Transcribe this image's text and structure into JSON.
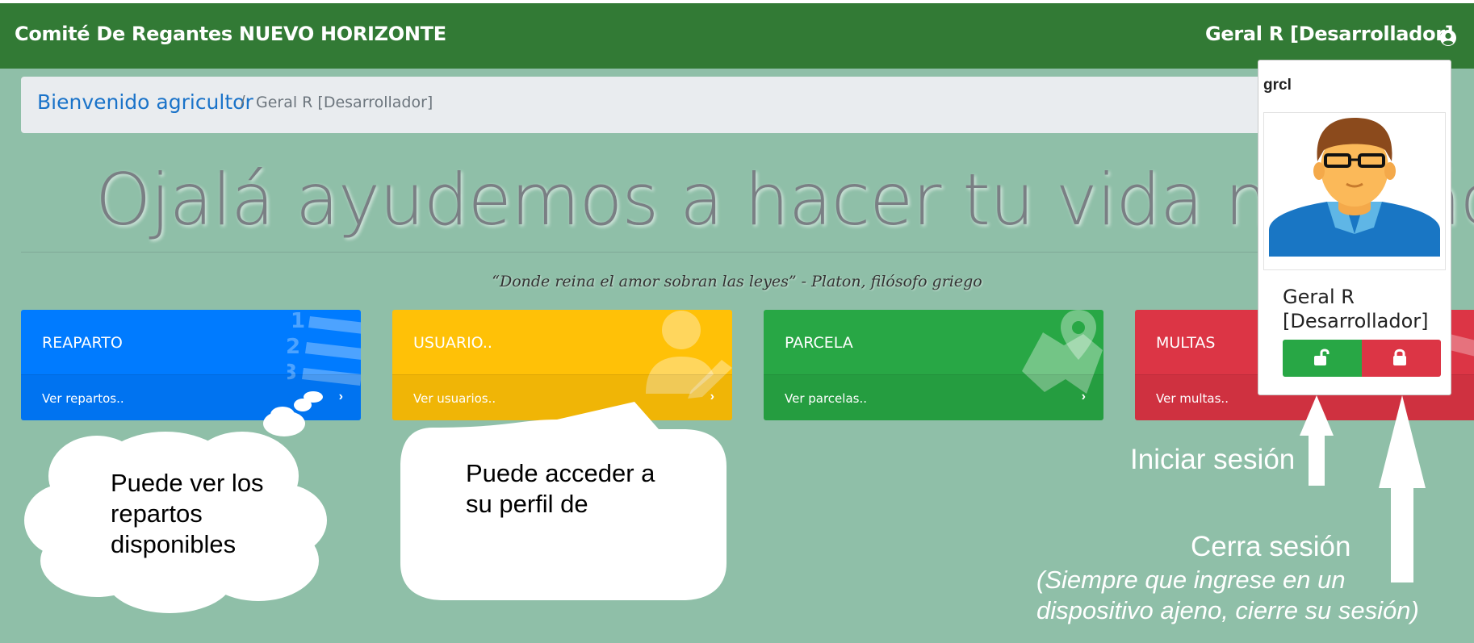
{
  "navbar": {
    "brand": "Comité De Regantes NUEVO HORIZONTE",
    "user_name": "Geral R [Desarrollador]",
    "user_icon": "user-circle-icon"
  },
  "breadcrumb": {
    "home": "Bienvenido agricultor",
    "separator": "/",
    "current": "Geral R [Desarrollador]"
  },
  "hero": {
    "heading": "Ojalá ayudemos a hacer tu vida mas fácil",
    "quote": "“Donde reina el amor sobran las leyes” - Platon, filósofo griego"
  },
  "cards": [
    {
      "title": "REAPARTO",
      "link": "Ver repartos..",
      "chevron": "›",
      "icon": "numbered-list-icon",
      "color": "#007bff"
    },
    {
      "title": "USUARIO..",
      "link": "Ver usuarios..",
      "chevron": "›",
      "icon": "user-edit-icon",
      "color": "#ffc107"
    },
    {
      "title": "PARCELA",
      "link": "Ver parcelas..",
      "chevron": "›",
      "icon": "map-marker-icon",
      "color": "#28a745"
    },
    {
      "title": "MULTAS",
      "link": "Ver multas..",
      "chevron": "›",
      "icon": "warning-icon",
      "color": "#dc3545"
    }
  ],
  "user_popover": {
    "username": "grcl",
    "display_name": "Geral R [Desarrollador]",
    "avatar_icon": "user-avatar-icon",
    "login_icon": "unlock-icon",
    "logout_icon": "lock-icon"
  },
  "annotations": {
    "callout_repartos": "Puede ver los repartos disponibles",
    "callout_perfil": "Puede acceder a su perfil de",
    "login_label": "Iniciar sesión",
    "logout_label": "Cerra sesión",
    "logout_note": "(Siempre que ingrese en un dispositivo ajeno, cierre su sesión)"
  }
}
